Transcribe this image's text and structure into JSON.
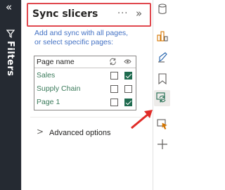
{
  "filters_rail": {
    "expand_glyph": "«",
    "label": "Filters",
    "icon": "funnel-icon"
  },
  "sync_pane": {
    "title": "Sync slicers",
    "more_glyph": "···",
    "collapse_glyph": "»",
    "description_line1": "Add and sync with all pages,",
    "description_line2": "or select specific pages:",
    "table": {
      "header_name": "Page name",
      "sync_icon": "sync-icon",
      "visible_icon": "eye-icon",
      "rows": [
        {
          "name": "Sales",
          "sync": false,
          "visible": true
        },
        {
          "name": "Supply Chain",
          "sync": false,
          "visible": false
        },
        {
          "name": "Page 1",
          "sync": false,
          "visible": true
        }
      ]
    },
    "advanced_options": "Advanced options",
    "advanced_glyph": ">"
  },
  "icon_bar": {
    "items": [
      "cylinder-data-icon",
      "format-visual-icon",
      "analytics-paintbrush-icon",
      "bookmark-icon",
      "sync-slicers-icon",
      "selection-pane-icon",
      "add-icon"
    ],
    "selected": "sync-slicers-icon"
  },
  "annotation": {
    "highlight_color": "#e0484e",
    "arrow_color": "#e02b27"
  },
  "colors": {
    "accent_green": "#1f6b4f",
    "link_blue": "#4472c4",
    "rail_dark": "#252a32"
  }
}
